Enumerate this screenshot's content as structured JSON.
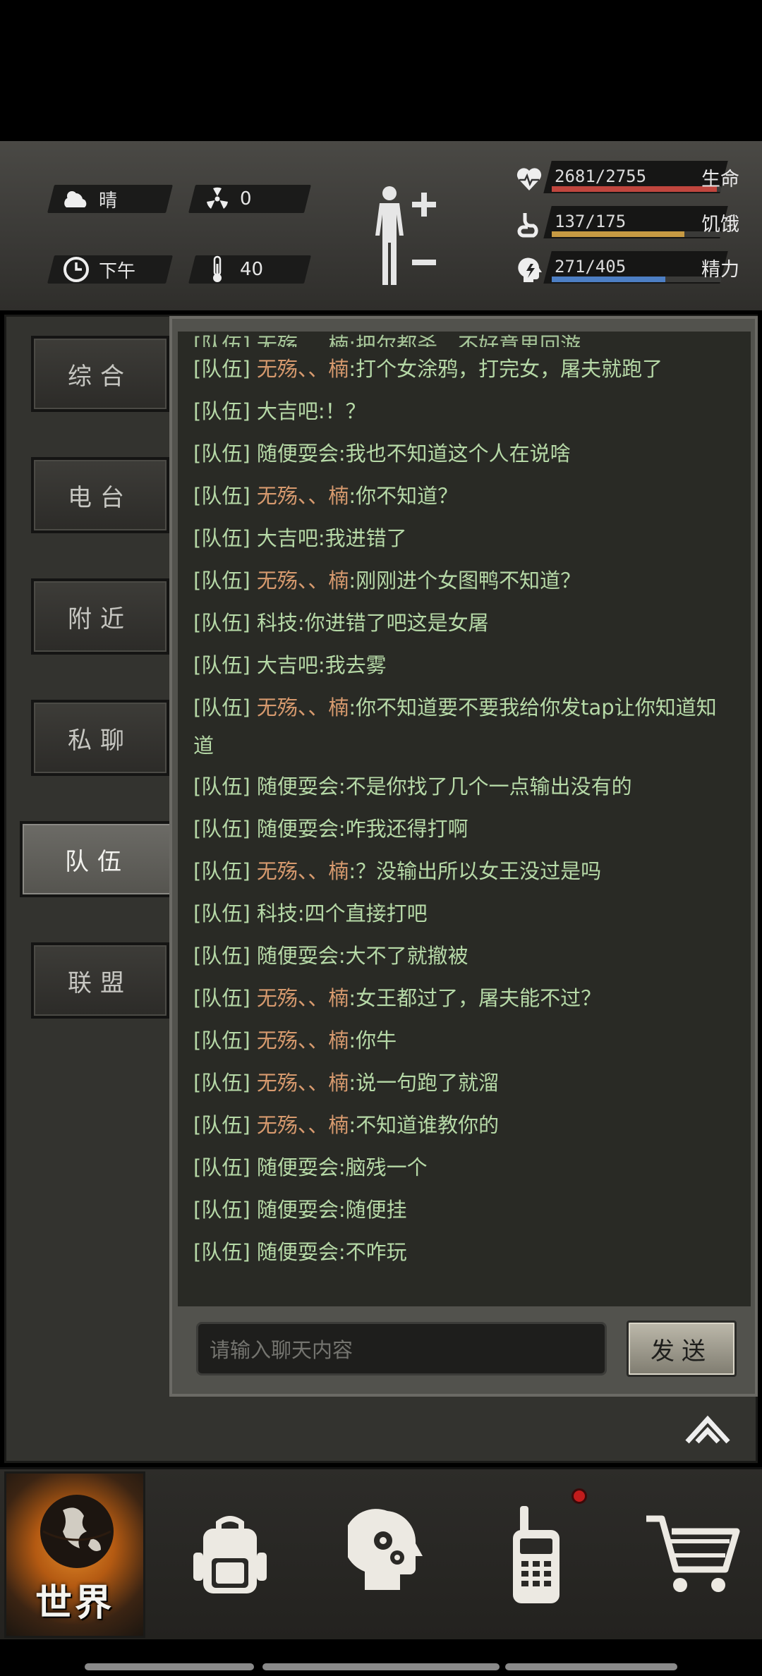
{
  "status": {
    "weather": "晴",
    "radiation": "0",
    "time_of_day": "下午",
    "temperature": "40",
    "stats": [
      {
        "name": "生命",
        "value": "2681/2755",
        "current": 2681,
        "max": 2755,
        "color": "#c0463e",
        "icon": "heart-pulse-icon"
      },
      {
        "name": "饥饿",
        "value": "137/175",
        "current": 137,
        "max": 175,
        "color": "#c79a43",
        "icon": "stomach-icon"
      },
      {
        "name": "精力",
        "value": "271/405",
        "current": 271,
        "max": 405,
        "color": "#4d7fc4",
        "icon": "head-energy-icon"
      }
    ]
  },
  "tabs": [
    {
      "label": "综合",
      "active": false
    },
    {
      "label": "电台",
      "active": false
    },
    {
      "label": "附近",
      "active": false
    },
    {
      "label": "私聊",
      "active": false
    },
    {
      "label": "队伍",
      "active": true
    },
    {
      "label": "联盟",
      "active": false
    }
  ],
  "chat": {
    "partial_top": "[队伍] 无殇、、楠:把尔都杀，不好意思回游",
    "messages": [
      {
        "tag": "[队伍]",
        "name": "无殇、、楠",
        "text": ":打个女涂鸦，打完女，屠夫就跑了",
        "highlight": true
      },
      {
        "tag": "[队伍]",
        "name": "大吉吧",
        "text": ":！？",
        "highlight": false
      },
      {
        "tag": "[队伍]",
        "name": "随便耍会",
        "text": ":我也不知道这个人在说啥",
        "highlight": false
      },
      {
        "tag": "[队伍]",
        "name": "无殇、、楠",
        "text": ":你不知道？",
        "highlight": true
      },
      {
        "tag": "[队伍]",
        "name": "大吉吧",
        "text": ":我进错了",
        "highlight": false
      },
      {
        "tag": "[队伍]",
        "name": "无殇、、楠",
        "text": ":刚刚进个女图鸭不知道？",
        "highlight": true
      },
      {
        "tag": "[队伍]",
        "name": "科技",
        "text": ":你进错了吧这是女屠",
        "highlight": false
      },
      {
        "tag": "[队伍]",
        "name": "大吉吧",
        "text": ":我去雾",
        "highlight": false
      },
      {
        "tag": "[队伍]",
        "name": "无殇、、楠",
        "text": ":你不知道要不要我给你发tap让你知道知道",
        "highlight": true,
        "wrap": true
      },
      {
        "tag": "[队伍]",
        "name": "随便耍会",
        "text": ":不是你找了几个一点输出没有的",
        "highlight": false
      },
      {
        "tag": "[队伍]",
        "name": "随便耍会",
        "text": ":咋我还得打啊",
        "highlight": false
      },
      {
        "tag": "[队伍]",
        "name": "无殇、、楠",
        "text": ":？没输出所以女王没过是吗",
        "highlight": true
      },
      {
        "tag": "[队伍]",
        "name": "科技",
        "text": ":四个直接打吧",
        "highlight": false
      },
      {
        "tag": "[队伍]",
        "name": "随便耍会",
        "text": ":大不了就撤被",
        "highlight": false
      },
      {
        "tag": "[队伍]",
        "name": "无殇、、楠",
        "text": ":女王都过了，屠夫能不过？",
        "highlight": true
      },
      {
        "tag": "[队伍]",
        "name": "无殇、、楠",
        "text": ":你牛",
        "highlight": true
      },
      {
        "tag": "[队伍]",
        "name": "无殇、、楠",
        "text": ":说一句跑了就溜",
        "highlight": true
      },
      {
        "tag": "[队伍]",
        "name": "无殇、、楠",
        "text": ":不知道谁教你的",
        "highlight": true
      },
      {
        "tag": "[队伍]",
        "name": "随便耍会",
        "text": ":脑残一个",
        "highlight": false
      },
      {
        "tag": "[队伍]",
        "name": "随便耍会",
        "text": ":随便挂",
        "highlight": false
      },
      {
        "tag": "[队伍]",
        "name": "随便耍会",
        "text": ":不咋玩",
        "highlight": false
      }
    ],
    "input_placeholder": "请输入聊天内容",
    "send_label": "发送"
  },
  "nav": {
    "items": [
      {
        "label": "世界",
        "icon": "globe-icon",
        "active": true
      },
      {
        "label": "",
        "icon": "backpack-icon",
        "active": false
      },
      {
        "label": "",
        "icon": "head-gears-icon",
        "active": false
      },
      {
        "label": "",
        "icon": "walkie-talkie-icon",
        "active": false,
        "notification": true
      },
      {
        "label": "",
        "icon": "shopping-cart-icon",
        "active": false
      }
    ]
  }
}
